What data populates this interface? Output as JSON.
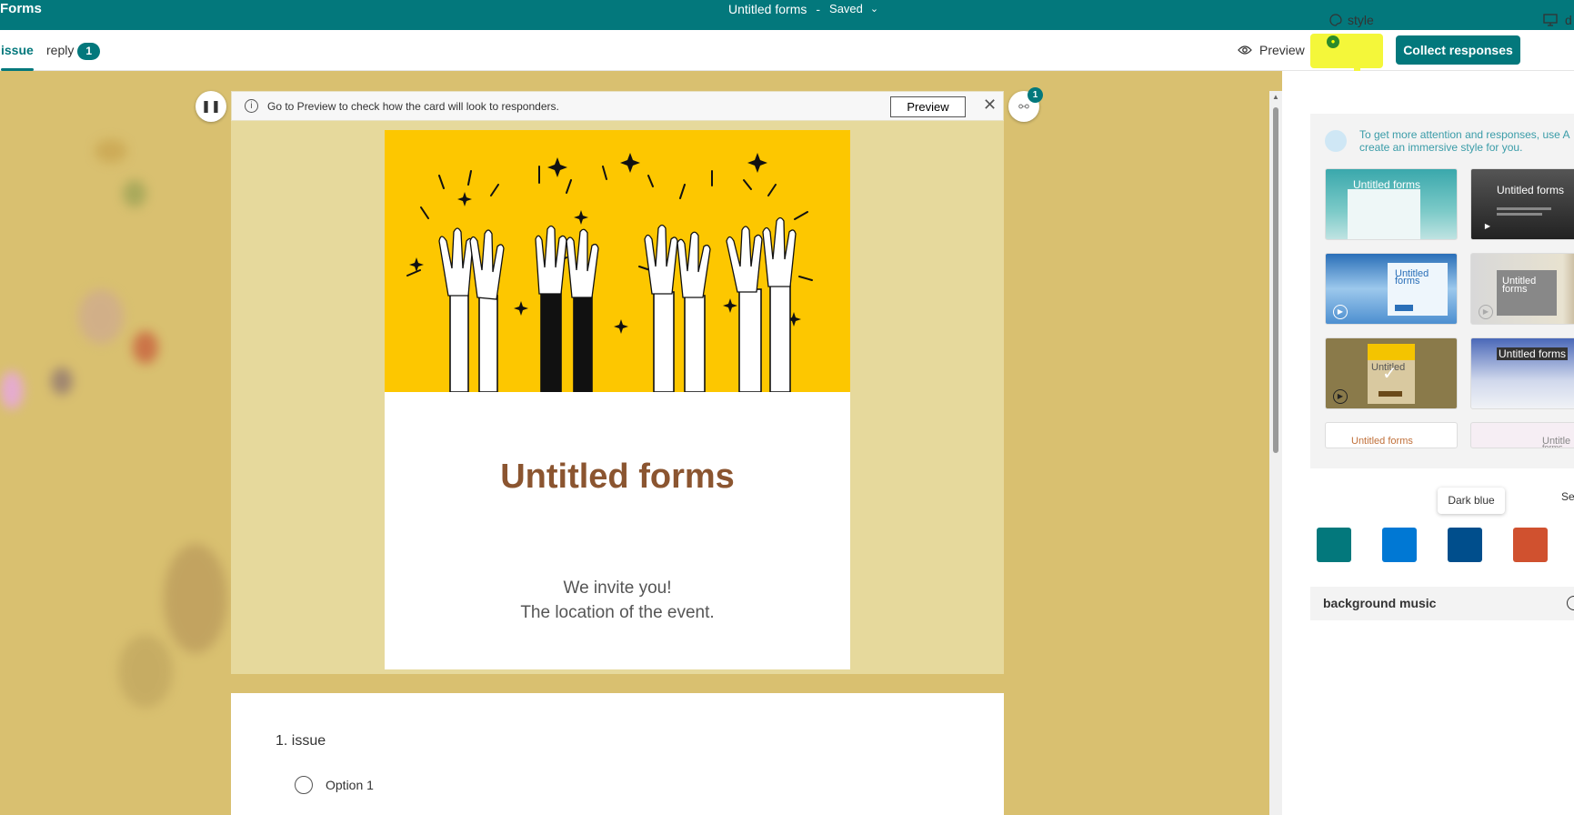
{
  "app": {
    "name": "Forms"
  },
  "header": {
    "title": "Untitled forms",
    "separator": "-",
    "status": "Saved"
  },
  "nav": {
    "tabs": [
      {
        "label": "issue"
      },
      {
        "label": "reply",
        "badge": "1"
      }
    ],
    "preview_label": "Preview",
    "style_label": "style",
    "collect_label": "Collect responses",
    "present_label": "d"
  },
  "info_bar": {
    "message": "Go to Preview to check how the card will look to responders.",
    "preview_button": "Preview"
  },
  "hint_badge": "1",
  "cover": {
    "title": "Untitled forms",
    "line1": "We invite you!",
    "line2": "The location of the event."
  },
  "question": {
    "title": "1. issue",
    "options": [
      "Option 1"
    ]
  },
  "panel": {
    "ai_line1": "To get more attention and responses, use A",
    "ai_line2": "create an immersive style for you.",
    "themes": [
      {
        "label": "Untitled forms"
      },
      {
        "label": "Untitled forms"
      },
      {
        "label_line1": "Untitled",
        "label_line2": "forms"
      },
      {
        "label_line1": "Untitled",
        "label_line2": "forms"
      },
      {
        "label": "Untitled"
      },
      {
        "label": "Untitled forms"
      },
      {
        "label": "Untitled forms"
      },
      {
        "label_line1": "Untitle",
        "label_line2": "forms"
      }
    ],
    "tooltip": "Dark blue",
    "select_more": "Se",
    "colors": [
      "#03787c",
      "#0078d4",
      "#004e8c",
      "#d0512f"
    ],
    "music_label": "background music"
  },
  "brand_color": "#03787c"
}
